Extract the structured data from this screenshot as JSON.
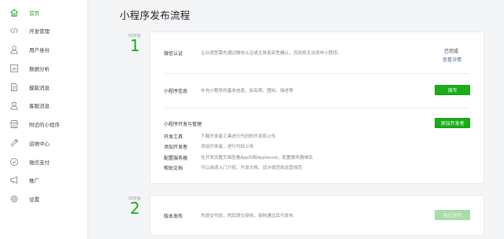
{
  "sidebar": {
    "items": [
      {
        "label": "首页",
        "icon": "home-icon"
      },
      {
        "label": "开发管理",
        "icon": "code-icon"
      },
      {
        "label": "用户身份",
        "icon": "user-icon"
      },
      {
        "label": "数据分析",
        "icon": "chart-icon"
      },
      {
        "label": "模版消息",
        "icon": "document-icon"
      },
      {
        "label": "客服消息",
        "icon": "customer-service-icon"
      },
      {
        "label": "附近的小程序",
        "icon": "store-icon"
      },
      {
        "label": "运维中心",
        "icon": "wrench-icon"
      },
      {
        "label": "微信支付",
        "icon": "payment-icon"
      },
      {
        "label": "推广",
        "icon": "megaphone-icon"
      },
      {
        "label": "设置",
        "icon": "gear-icon"
      }
    ],
    "active_index": 0
  },
  "main": {
    "title": "小程序发布流程",
    "step1": {
      "step_label": "step",
      "step_number": "1",
      "verify": {
        "label": "微信认证",
        "desc": "企业类型需先通过微信认证或主体真实性确认，否则将无法发布小程序。",
        "status": "已完成",
        "link": "查看详情"
      },
      "info": {
        "label": "小程序信息",
        "desc": "补充小程序的基本信息，如名称、图标、描述等",
        "button": "填写"
      },
      "dev": {
        "heading": "小程序开发与管理",
        "button": "添加开发者",
        "items": [
          {
            "label": "开发工具",
            "desc": "下载开发者工具进行代码的开发和上传"
          },
          {
            "label": "添加开发者",
            "desc": "添加开发者，进行代码上传"
          },
          {
            "label": "配置服务器",
            "desc": "在开发设置页面查看AppID和AppSecret，配置服务器域名"
          },
          {
            "label": "帮助文档",
            "desc": "可以阅读入门介绍、开发文档、设计规范和运营规范"
          }
        ]
      }
    },
    "step2": {
      "step_label": "step",
      "step_number": "2",
      "release": {
        "label": "版本发布",
        "desc": "先提交代码，然后提交审核，审核通过后可发布",
        "button": "前往发布"
      }
    }
  },
  "colors": {
    "accent": "#1aad19",
    "link": "#4a6fa5"
  }
}
